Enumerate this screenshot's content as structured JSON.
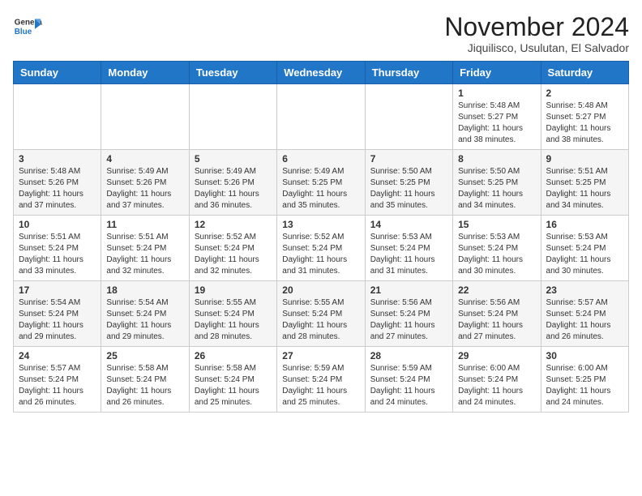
{
  "header": {
    "logo_line1": "General",
    "logo_line2": "Blue",
    "month_title": "November 2024",
    "location": "Jiquilisco, Usulutan, El Salvador"
  },
  "weekdays": [
    "Sunday",
    "Monday",
    "Tuesday",
    "Wednesday",
    "Thursday",
    "Friday",
    "Saturday"
  ],
  "weeks": [
    [
      {
        "day": "",
        "info": ""
      },
      {
        "day": "",
        "info": ""
      },
      {
        "day": "",
        "info": ""
      },
      {
        "day": "",
        "info": ""
      },
      {
        "day": "",
        "info": ""
      },
      {
        "day": "1",
        "info": "Sunrise: 5:48 AM\nSunset: 5:27 PM\nDaylight: 11 hours\nand 38 minutes."
      },
      {
        "day": "2",
        "info": "Sunrise: 5:48 AM\nSunset: 5:27 PM\nDaylight: 11 hours\nand 38 minutes."
      }
    ],
    [
      {
        "day": "3",
        "info": "Sunrise: 5:48 AM\nSunset: 5:26 PM\nDaylight: 11 hours\nand 37 minutes."
      },
      {
        "day": "4",
        "info": "Sunrise: 5:49 AM\nSunset: 5:26 PM\nDaylight: 11 hours\nand 37 minutes."
      },
      {
        "day": "5",
        "info": "Sunrise: 5:49 AM\nSunset: 5:26 PM\nDaylight: 11 hours\nand 36 minutes."
      },
      {
        "day": "6",
        "info": "Sunrise: 5:49 AM\nSunset: 5:25 PM\nDaylight: 11 hours\nand 35 minutes."
      },
      {
        "day": "7",
        "info": "Sunrise: 5:50 AM\nSunset: 5:25 PM\nDaylight: 11 hours\nand 35 minutes."
      },
      {
        "day": "8",
        "info": "Sunrise: 5:50 AM\nSunset: 5:25 PM\nDaylight: 11 hours\nand 34 minutes."
      },
      {
        "day": "9",
        "info": "Sunrise: 5:51 AM\nSunset: 5:25 PM\nDaylight: 11 hours\nand 34 minutes."
      }
    ],
    [
      {
        "day": "10",
        "info": "Sunrise: 5:51 AM\nSunset: 5:24 PM\nDaylight: 11 hours\nand 33 minutes."
      },
      {
        "day": "11",
        "info": "Sunrise: 5:51 AM\nSunset: 5:24 PM\nDaylight: 11 hours\nand 32 minutes."
      },
      {
        "day": "12",
        "info": "Sunrise: 5:52 AM\nSunset: 5:24 PM\nDaylight: 11 hours\nand 32 minutes."
      },
      {
        "day": "13",
        "info": "Sunrise: 5:52 AM\nSunset: 5:24 PM\nDaylight: 11 hours\nand 31 minutes."
      },
      {
        "day": "14",
        "info": "Sunrise: 5:53 AM\nSunset: 5:24 PM\nDaylight: 11 hours\nand 31 minutes."
      },
      {
        "day": "15",
        "info": "Sunrise: 5:53 AM\nSunset: 5:24 PM\nDaylight: 11 hours\nand 30 minutes."
      },
      {
        "day": "16",
        "info": "Sunrise: 5:53 AM\nSunset: 5:24 PM\nDaylight: 11 hours\nand 30 minutes."
      }
    ],
    [
      {
        "day": "17",
        "info": "Sunrise: 5:54 AM\nSunset: 5:24 PM\nDaylight: 11 hours\nand 29 minutes."
      },
      {
        "day": "18",
        "info": "Sunrise: 5:54 AM\nSunset: 5:24 PM\nDaylight: 11 hours\nand 29 minutes."
      },
      {
        "day": "19",
        "info": "Sunrise: 5:55 AM\nSunset: 5:24 PM\nDaylight: 11 hours\nand 28 minutes."
      },
      {
        "day": "20",
        "info": "Sunrise: 5:55 AM\nSunset: 5:24 PM\nDaylight: 11 hours\nand 28 minutes."
      },
      {
        "day": "21",
        "info": "Sunrise: 5:56 AM\nSunset: 5:24 PM\nDaylight: 11 hours\nand 27 minutes."
      },
      {
        "day": "22",
        "info": "Sunrise: 5:56 AM\nSunset: 5:24 PM\nDaylight: 11 hours\nand 27 minutes."
      },
      {
        "day": "23",
        "info": "Sunrise: 5:57 AM\nSunset: 5:24 PM\nDaylight: 11 hours\nand 26 minutes."
      }
    ],
    [
      {
        "day": "24",
        "info": "Sunrise: 5:57 AM\nSunset: 5:24 PM\nDaylight: 11 hours\nand 26 minutes."
      },
      {
        "day": "25",
        "info": "Sunrise: 5:58 AM\nSunset: 5:24 PM\nDaylight: 11 hours\nand 26 minutes."
      },
      {
        "day": "26",
        "info": "Sunrise: 5:58 AM\nSunset: 5:24 PM\nDaylight: 11 hours\nand 25 minutes."
      },
      {
        "day": "27",
        "info": "Sunrise: 5:59 AM\nSunset: 5:24 PM\nDaylight: 11 hours\nand 25 minutes."
      },
      {
        "day": "28",
        "info": "Sunrise: 5:59 AM\nSunset: 5:24 PM\nDaylight: 11 hours\nand 24 minutes."
      },
      {
        "day": "29",
        "info": "Sunrise: 6:00 AM\nSunset: 5:24 PM\nDaylight: 11 hours\nand 24 minutes."
      },
      {
        "day": "30",
        "info": "Sunrise: 6:00 AM\nSunset: 5:25 PM\nDaylight: 11 hours\nand 24 minutes."
      }
    ]
  ]
}
